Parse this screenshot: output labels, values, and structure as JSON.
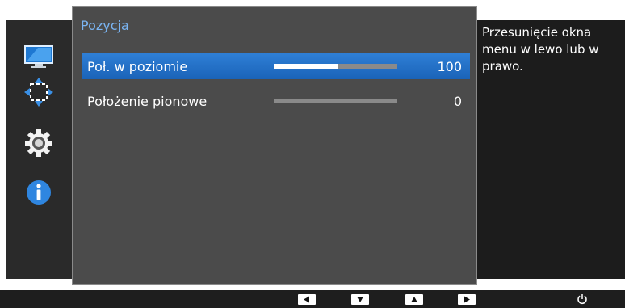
{
  "menu": {
    "title": "Pozycja",
    "items": [
      {
        "label": "Poł. w poziomie",
        "value": "100",
        "level": 0.52,
        "selected": true
      },
      {
        "label": "Położenie pionowe",
        "value": "0",
        "level": 0.0,
        "selected": false
      }
    ]
  },
  "sidebar": {
    "icons": [
      "monitor-icon",
      "position-arrows-icon",
      "gear-icon",
      "info-icon"
    ],
    "accent": "#2f7fd6"
  },
  "help": {
    "text": "Przesunięcie okna menu w lewo lub w prawo."
  },
  "bottom_bar": {
    "buttons": [
      "left-arrow-icon",
      "down-arrow-icon",
      "up-arrow-icon",
      "right-arrow-icon",
      "power-icon"
    ]
  },
  "colors": {
    "title": "#7ab4f2",
    "selected_row": "#2f7fd6",
    "panel": "#4b4b4b",
    "background": "#1c1c1c"
  }
}
